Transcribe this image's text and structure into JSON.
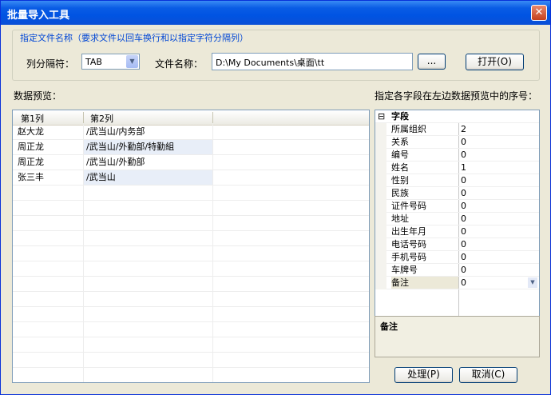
{
  "window": {
    "title": "批量导入工具",
    "close": "✕"
  },
  "group": {
    "legend": "指定文件名称（要求文件以回车换行和以指定字符分隔列）"
  },
  "separator": {
    "label": "列分隔符：",
    "value": "TAB"
  },
  "file": {
    "label": "文件名称：",
    "value": "D:\\My Documents\\桌面\\tt",
    "browse": "...",
    "open": "打开(O)"
  },
  "preview": {
    "label": "数据预览：",
    "columns": [
      "第1列",
      "第2列"
    ],
    "rows": [
      [
        "赵大龙",
        "/武当山/内务部"
      ],
      [
        "周正龙",
        "/武当山/外勤部/特勤組"
      ],
      [
        "周正龙",
        "/武当山/外勤部"
      ],
      [
        "张三丰",
        "/武当山"
      ]
    ]
  },
  "mapping": {
    "label": "指定各字段在左边数据预览中的序号：",
    "category": "字段",
    "expander": "⊟",
    "fields": [
      {
        "name": "所属组织",
        "value": "2"
      },
      {
        "name": "关系",
        "value": "0"
      },
      {
        "name": "编号",
        "value": "0"
      },
      {
        "name": "姓名",
        "value": "1"
      },
      {
        "name": "性别",
        "value": "0"
      },
      {
        "name": "民族",
        "value": "0"
      },
      {
        "name": "证件号码",
        "value": "0"
      },
      {
        "name": "地址",
        "value": "0"
      },
      {
        "name": "出生年月",
        "value": "0"
      },
      {
        "name": "电话号码",
        "value": "0"
      },
      {
        "name": "手机号码",
        "value": "0"
      },
      {
        "name": "车牌号",
        "value": "0"
      },
      {
        "name": "备注",
        "value": "0"
      }
    ],
    "description_title": "备注"
  },
  "buttons": {
    "process": "处理(P)",
    "cancel": "取消(C)"
  }
}
